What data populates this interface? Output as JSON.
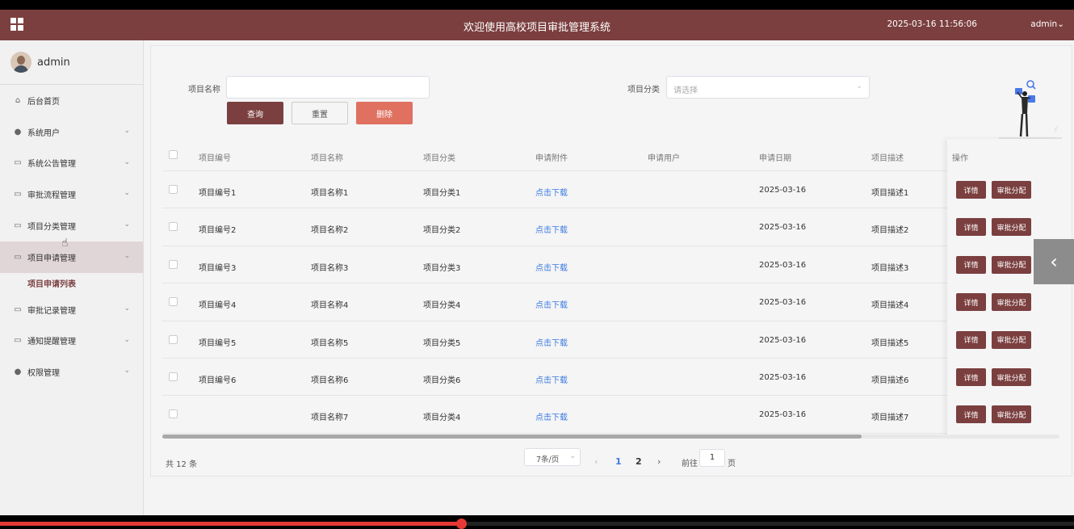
{
  "header": {
    "title": "欢迎使用高校项目审批管理系统",
    "datetime": "2025-03-16 11:56:06",
    "user": "admin",
    "user_caret": "⌄"
  },
  "sidebar": {
    "username": "admin",
    "items": [
      {
        "label": "后台首页",
        "icon": "home-icon"
      },
      {
        "label": "系统用户",
        "icon": "user-icon"
      },
      {
        "label": "系统公告管理",
        "icon": "doc-icon"
      },
      {
        "label": "审批流程管理",
        "icon": "doc-icon"
      },
      {
        "label": "项目分类管理",
        "icon": "doc-icon"
      },
      {
        "label": "项目申请管理",
        "icon": "doc-icon"
      },
      {
        "label": "审批记录管理",
        "icon": "doc-icon"
      },
      {
        "label": "通知提醒管理",
        "icon": "doc-icon"
      },
      {
        "label": "权限管理",
        "icon": "user-icon"
      }
    ],
    "sub_item": "项目申请列表"
  },
  "search": {
    "name_label": "项目名称",
    "name_value": "",
    "category_label": "项目分类",
    "category_placeholder": "请选择",
    "query_btn": "查询",
    "reset_btn": "重置",
    "delete_btn": "删除"
  },
  "table": {
    "headers": [
      "项目编号",
      "项目名称",
      "项目分类",
      "申请附件",
      "申请用户",
      "申请日期",
      "项目描述",
      "操作"
    ],
    "rows": [
      {
        "code": "项目编号1",
        "name": "项目名称1",
        "category": "项目分类1",
        "attachment": "点击下载",
        "user": "",
        "date": "2025-03-16",
        "desc": "项目描述1"
      },
      {
        "code": "项目编号2",
        "name": "项目名称2",
        "category": "项目分类2",
        "attachment": "点击下载",
        "user": "",
        "date": "2025-03-16",
        "desc": "项目描述2"
      },
      {
        "code": "项目编号3",
        "name": "项目名称3",
        "category": "项目分类3",
        "attachment": "点击下载",
        "user": "",
        "date": "2025-03-16",
        "desc": "项目描述3"
      },
      {
        "code": "项目编号4",
        "name": "项目名称4",
        "category": "项目分类4",
        "attachment": "点击下载",
        "user": "",
        "date": "2025-03-16",
        "desc": "项目描述4"
      },
      {
        "code": "项目编号5",
        "name": "项目名称5",
        "category": "项目分类5",
        "attachment": "点击下载",
        "user": "",
        "date": "2025-03-16",
        "desc": "项目描述5"
      },
      {
        "code": "项目编号6",
        "name": "项目名称6",
        "category": "项目分类6",
        "attachment": "点击下载",
        "user": "",
        "date": "2025-03-16",
        "desc": "项目描述6"
      },
      {
        "code": "",
        "name": "项目名称7",
        "category": "项目分类4",
        "attachment": "点击下载",
        "user": "",
        "date": "2025-03-16",
        "desc": "项目描述7"
      }
    ],
    "detail_btn": "详情",
    "assign_btn": "审批分配"
  },
  "pagination": {
    "total": "共 12 条",
    "page_size": "7条/页",
    "prev": "‹",
    "pages": [
      "1",
      "2"
    ],
    "current": "1",
    "next": "›",
    "goto_prefix": "前往",
    "goto_value": "1",
    "goto_suffix": "页"
  },
  "colors": {
    "brand": "#7b3f3f",
    "delete": "#e07060",
    "link": "#3c7be0"
  },
  "video": {
    "played_fraction": 0.43
  }
}
